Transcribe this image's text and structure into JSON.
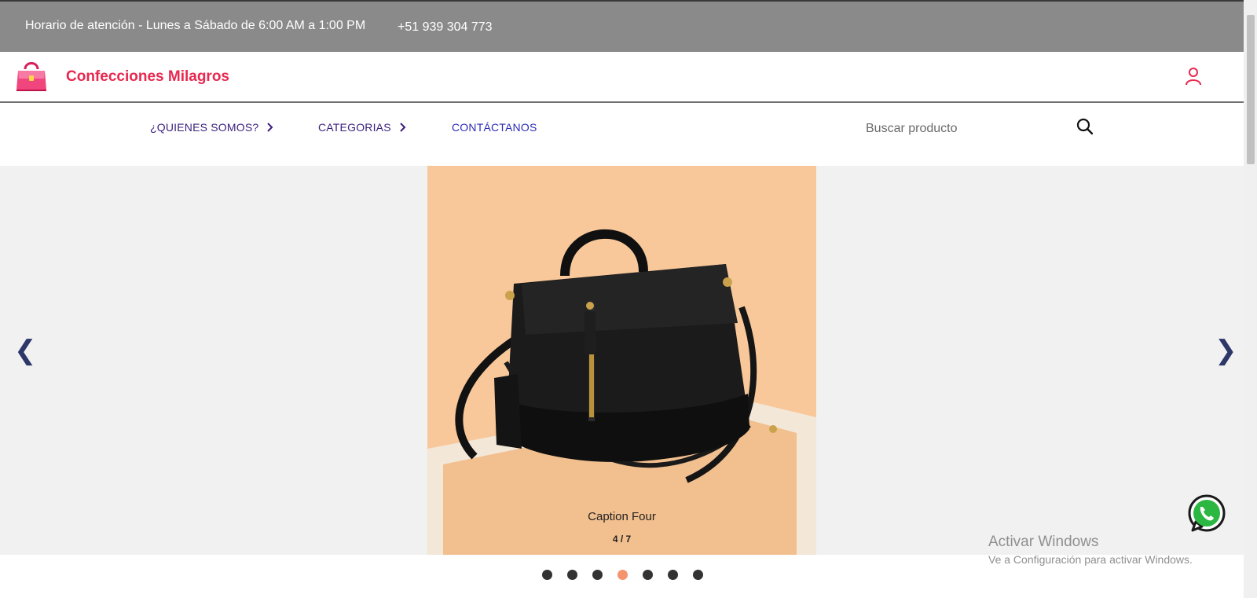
{
  "topbar": {
    "hours": "Horario de atención - Lunes a Sábado de 6:00 AM a 1:00 PM",
    "phone": "+51 939 304 773"
  },
  "brand": {
    "name": "Confecciones Milagros",
    "logo_icon": "handbag-logo-icon",
    "accent_color": "#e8284f"
  },
  "header": {
    "user_icon": "user-icon"
  },
  "nav": {
    "items": [
      {
        "label": "¿QUIENES SOMOS?",
        "has_chevron": true
      },
      {
        "label": "CATEGORIAS",
        "has_chevron": true
      },
      {
        "label": "CONTÁCTANOS",
        "has_chevron": false
      }
    ]
  },
  "search": {
    "placeholder": "Buscar producto",
    "icon": "search-icon"
  },
  "carousel": {
    "caption": "Caption Four",
    "counter": "4 / 7",
    "prev_symbol": "❮",
    "next_symbol": "❯",
    "total_slides": 7,
    "active_index": 4,
    "active_dot_color": "#f4956e"
  },
  "floating": {
    "whatsapp_icon": "whatsapp-icon"
  },
  "watermark": {
    "title": "Activar Windows",
    "subtitle": "Ve a Configuración para activar Windows."
  }
}
